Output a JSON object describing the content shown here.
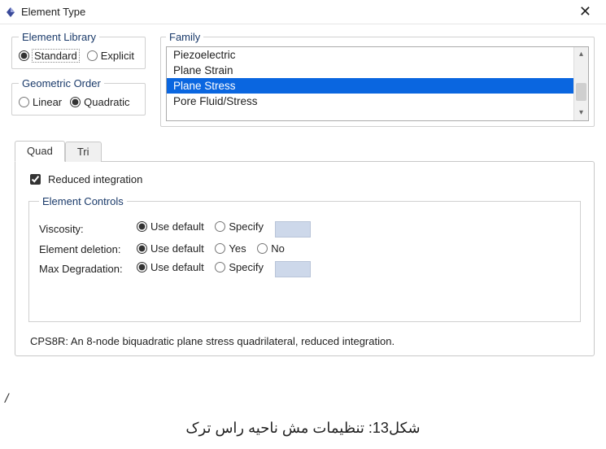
{
  "window": {
    "title": "Element Type",
    "close_label": "✕"
  },
  "element_library": {
    "legend": "Element Library",
    "standard": "Standard",
    "explicit": "Explicit",
    "selected": "standard"
  },
  "geometric_order": {
    "legend": "Geometric Order",
    "linear": "Linear",
    "quadratic": "Quadratic",
    "selected": "quadratic"
  },
  "family": {
    "legend": "Family",
    "items": [
      "Piezoelectric",
      "Plane Strain",
      "Plane Stress",
      "Pore Fluid/Stress"
    ],
    "selected_index": 2
  },
  "tabs": {
    "quad": "Quad",
    "tri": "Tri",
    "active": "quad"
  },
  "reduced_integration": {
    "label": "Reduced integration",
    "checked": true
  },
  "element_controls": {
    "legend": "Element Controls",
    "viscosity": {
      "label": "Viscosity:",
      "use_default": "Use default",
      "specify": "Specify",
      "selected": "use_default"
    },
    "element_deletion": {
      "label": "Element deletion:",
      "use_default": "Use default",
      "yes": "Yes",
      "no": "No",
      "selected": "use_default"
    },
    "max_degradation": {
      "label": "Max Degradation:",
      "use_default": "Use default",
      "specify": "Specify",
      "selected": "use_default"
    }
  },
  "description": "CPS8R:  An 8-node biquadratic plane stress quadrilateral, reduced integration.",
  "caption": "شکل13: تنظیمات مش ناحیه راس ترک"
}
